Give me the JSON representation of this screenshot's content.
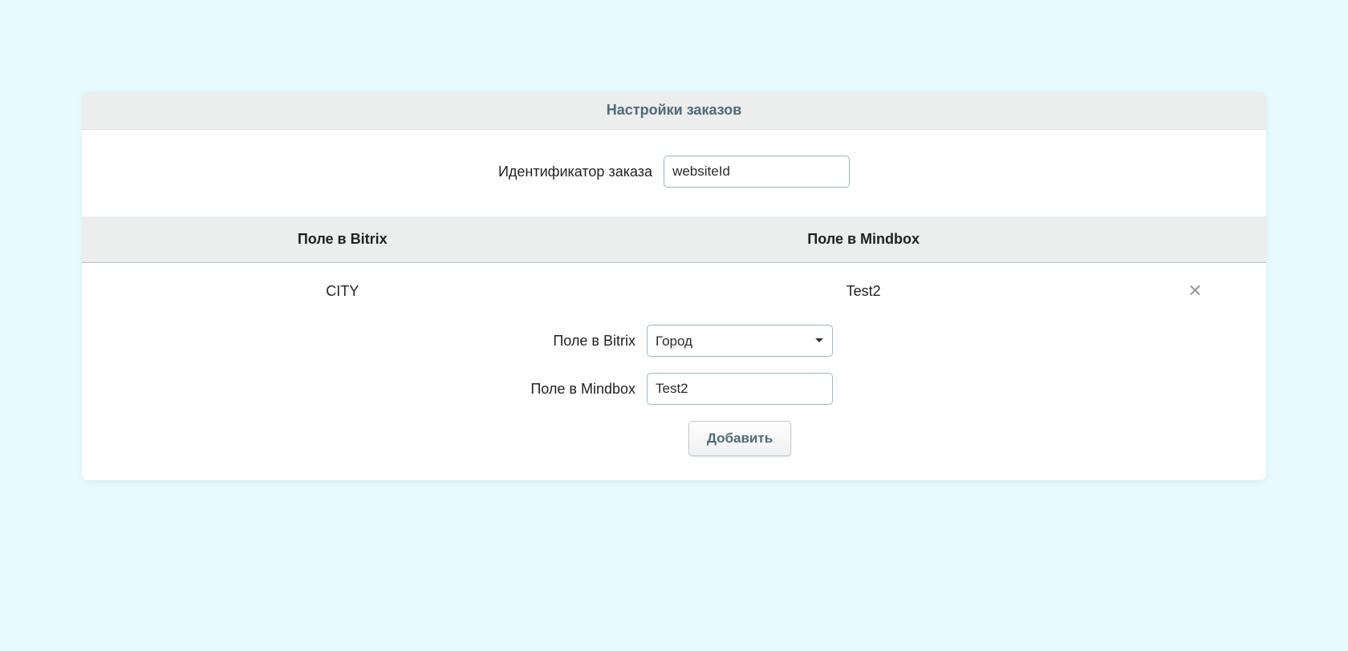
{
  "header": {
    "title": "Настройки заказов"
  },
  "order_id": {
    "label": "Идентификатор заказа",
    "value": "websiteId"
  },
  "mapping_table": {
    "col_bitrix": "Поле в Bitrix",
    "col_mindbox": "Поле в Mindbox",
    "rows": [
      {
        "bitrix": "CITY",
        "mindbox": "Test2"
      }
    ]
  },
  "form": {
    "bitrix_label": "Поле в Bitrix",
    "bitrix_select_value": "Город",
    "mindbox_label": "Поле в Mindbox",
    "mindbox_value": "Test2",
    "add_button": "Добавить"
  },
  "icons": {
    "delete": "✕"
  }
}
